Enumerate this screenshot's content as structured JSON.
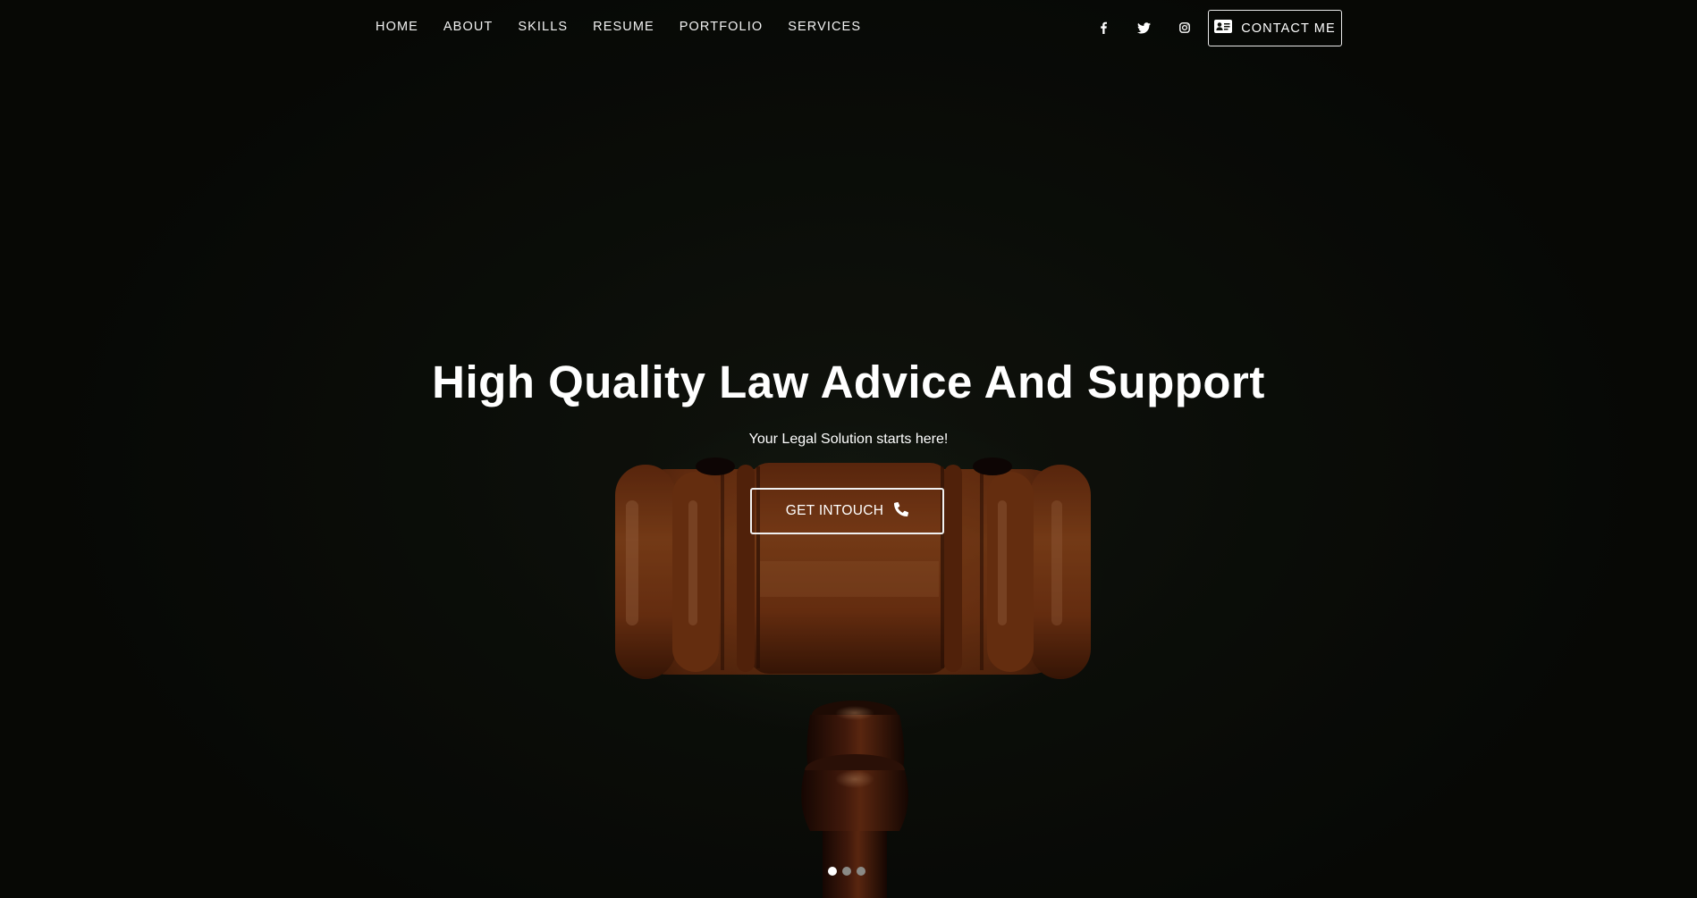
{
  "nav": {
    "links": [
      {
        "label": "HOME"
      },
      {
        "label": "ABOUT"
      },
      {
        "label": "SKILLS"
      },
      {
        "label": "RESUME"
      },
      {
        "label": "PORTFOLIO"
      },
      {
        "label": "SERVICES"
      }
    ],
    "social": [
      {
        "icon": "facebook-icon"
      },
      {
        "icon": "twitter-icon"
      },
      {
        "icon": "instagram-icon"
      }
    ],
    "contact_button": {
      "label": "CONTACT ME",
      "icon": "contact-card-icon"
    }
  },
  "hero": {
    "title": "High Quality Law Advice And Support",
    "subtitle": "Your Legal Solution starts here!",
    "cta": {
      "label": "GET INTOUCH",
      "icon": "phone-icon"
    },
    "background_image": "wooden gavel on dark background"
  },
  "slider": {
    "slide_count": 3,
    "active_index": 0
  },
  "colors": {
    "background": "#0d0f0a",
    "gavel_wood": "#8a3f17",
    "text": "#ffffff"
  }
}
